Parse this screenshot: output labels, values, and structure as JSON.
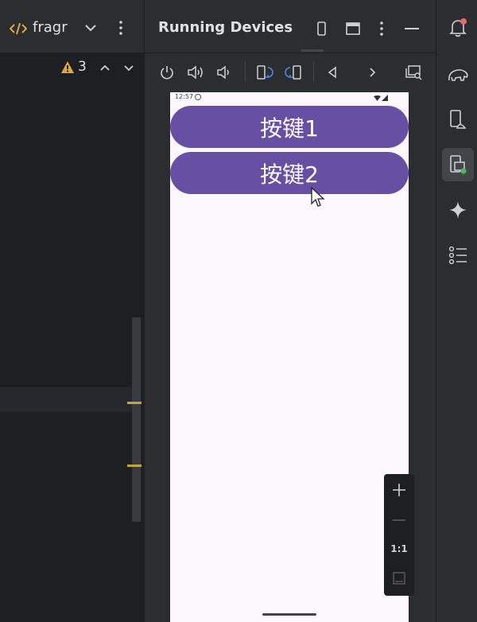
{
  "editor": {
    "tab": {
      "code_icon": "code-icon",
      "label": "fragr"
    },
    "warnings": {
      "count": "3"
    }
  },
  "devices": {
    "title": "Running Devices",
    "toolbar": [
      "power-icon",
      "volume-up-icon",
      "volume-down-icon",
      "rotate-left-icon",
      "rotate-right-icon",
      "back-icon",
      "forward-icon",
      "screenshot-icon"
    ]
  },
  "phone": {
    "status_time": "12:57",
    "buttons": [
      "按键1",
      "按键2"
    ]
  },
  "zoom": {
    "one_to_one": "1:1"
  },
  "strip": [
    "notifications-icon",
    "gradle-elephant-icon",
    "device-manager-icon",
    "running-devices-icon",
    "gemini-icon",
    "structure-list-icon"
  ],
  "colors": {
    "button_purple": "#6750a4",
    "phone_bg": "#fdf8fd",
    "warning": "#e0a93e",
    "marker": "#c7a04a",
    "notification_dot": "#e06c6c",
    "online_dot": "#4cbb5a"
  }
}
